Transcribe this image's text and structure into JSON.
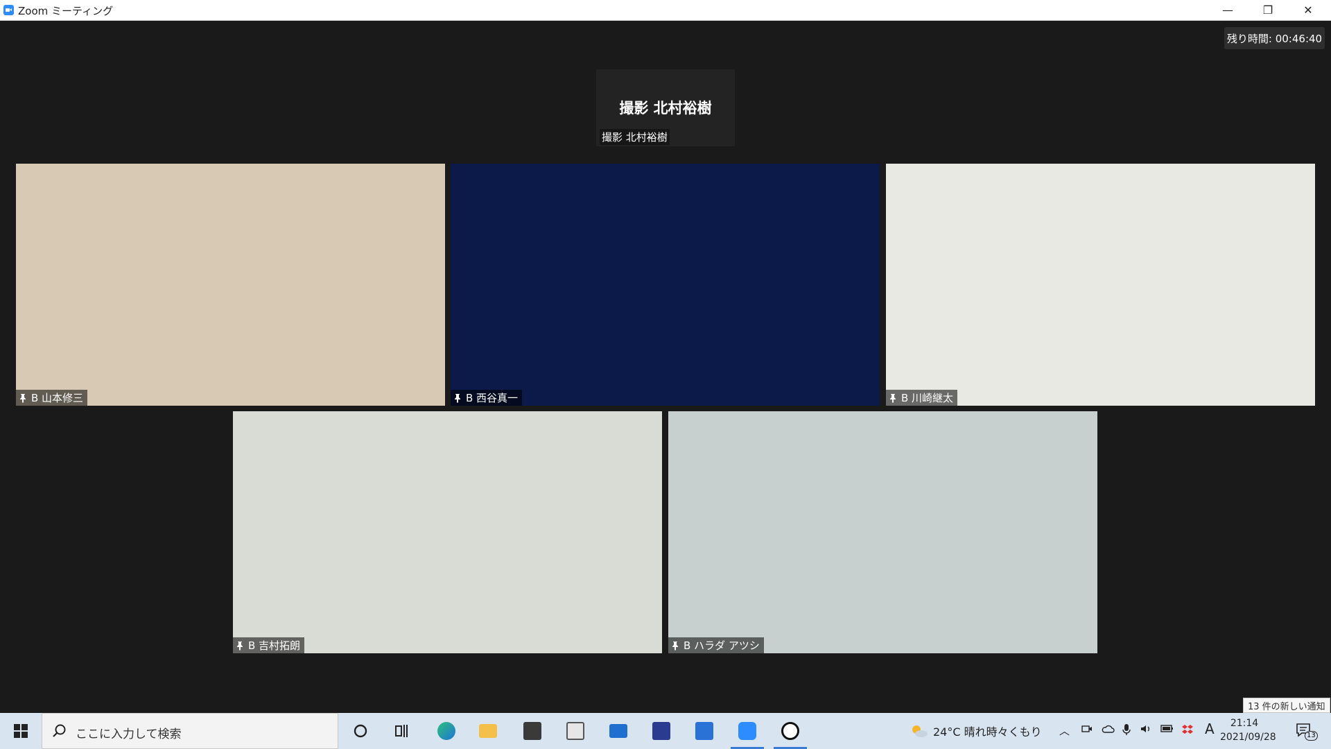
{
  "window": {
    "title": "Zoom ミーティング",
    "min": "—",
    "max": "❐",
    "close": "✕"
  },
  "timer": "残り時間: 00:46:40",
  "small_tile": {
    "center_name": "撮影 北村裕樹",
    "label": "撮影 北村裕樹"
  },
  "participants": [
    {
      "name": "B 山本修三"
    },
    {
      "name": "B 西谷真一"
    },
    {
      "name": "B 川崎継太"
    },
    {
      "name": "B 吉村拓朗"
    },
    {
      "name": "B ハラダ アツシ"
    }
  ],
  "taskbar": {
    "search_placeholder": "ここに入力して検索",
    "weather": "24°C 晴れ時々くもり",
    "ime": "A",
    "time": "21:14",
    "date": "2021/09/28",
    "notification_count": "13",
    "toast": "13 件の新しい通知"
  },
  "colors": {
    "zoom_blue": "#2d8cff",
    "meeting_bg": "#1a1a1a",
    "taskbar_bg": "#d9e4f1"
  }
}
